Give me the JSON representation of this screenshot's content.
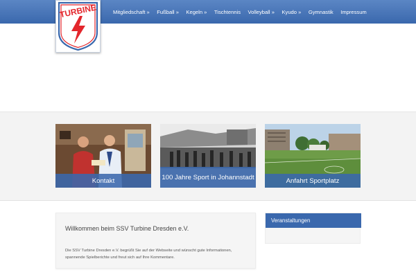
{
  "header": {
    "logo_text": "TURBINE",
    "nav": [
      "Mitgliedschaft »",
      "Fußball »",
      "Kegeln »",
      "Tischtennis",
      "Volleyball »",
      "Kyudo »",
      "Gymnastik",
      "Impressum"
    ]
  },
  "tiles": [
    {
      "label": "Kontakt"
    },
    {
      "label": "100 Jahre Sport in Johannstadt"
    },
    {
      "label": "Anfahrt Sportplatz"
    }
  ],
  "welcome": {
    "title": "Willkommen beim SSV Turbine Dresden e.V.",
    "text": "Die SSV Turbine Dresden e.V. begrüßt Sie auf der Webseite und wünscht gute Informationen, spannende Spielberichte und freut sich auf Ihre Kommentare."
  },
  "events": {
    "title": "Veranstaltungen"
  },
  "colors": {
    "brand_blue": "#3a68ad",
    "logo_red": "#e3262c"
  }
}
